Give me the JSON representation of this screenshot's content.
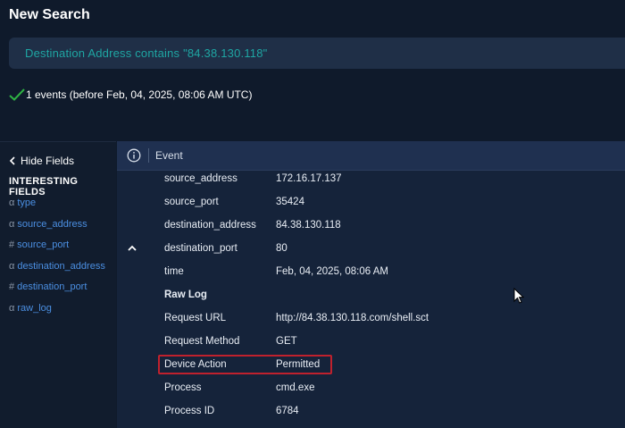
{
  "page": {
    "title": "New Search"
  },
  "search": {
    "query": "Destination Address contains \"84.38.130.118\""
  },
  "results": {
    "summary": "1 events (before Feb, 04, 2025, 08:06 AM UTC)",
    "status_icon": "checkmark-icon",
    "status_color": "#2fb344"
  },
  "sidebar": {
    "hide_fields_label": "Hide Fields",
    "interesting_header": "INTERESTING FIELDS",
    "fields": [
      {
        "type_glyph": "α",
        "name": "type"
      },
      {
        "type_glyph": "α",
        "name": "source_address"
      },
      {
        "type_glyph": "#",
        "name": "source_port"
      },
      {
        "type_glyph": "α",
        "name": "destination_address"
      },
      {
        "type_glyph": "#",
        "name": "destination_port"
      },
      {
        "type_glyph": "α",
        "name": "raw_log"
      }
    ]
  },
  "event": {
    "header_label": "Event",
    "header_icon": "info-icon",
    "rows": [
      {
        "key": "source_address",
        "value": "172.16.17.137"
      },
      {
        "key": "source_port",
        "value": "35424"
      },
      {
        "key": "destination_address",
        "value": "84.38.130.118"
      },
      {
        "key": "destination_port",
        "value": "80"
      },
      {
        "key": "time",
        "value": "Feb, 04, 2025, 08:06 AM"
      },
      {
        "key": "Raw Log",
        "value": ""
      },
      {
        "key": "Request URL",
        "value": "http://84.38.130.118.com/shell.sct"
      },
      {
        "key": "Request Method",
        "value": "GET"
      },
      {
        "key": "Device Action",
        "value": "Permitted"
      },
      {
        "key": "Process",
        "value": "cmd.exe"
      },
      {
        "key": "Process ID",
        "value": "6784"
      }
    ]
  },
  "colors": {
    "accent_teal": "#1fa6a3",
    "link_blue": "#4b8fe2",
    "highlight_red": "#c0212d"
  }
}
